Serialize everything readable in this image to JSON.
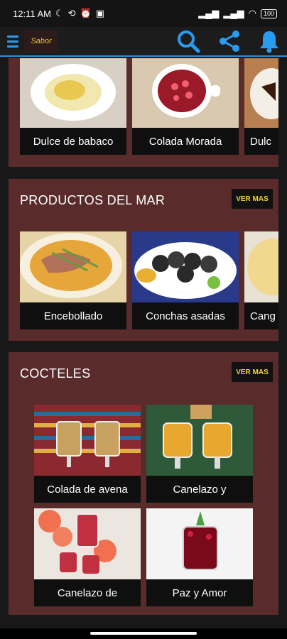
{
  "status_bar": {
    "time": "12:11 AM",
    "battery": "100"
  },
  "app": {
    "logo_text": "Sabor"
  },
  "sections": {
    "postres": {
      "items": [
        {
          "label": "Dulce de babaco",
          "image": "dulce-de-babaco"
        },
        {
          "label": "Colada Morada",
          "image": "colada-morada"
        },
        {
          "label": "Dulc",
          "image": "dessert-partial"
        }
      ]
    },
    "mar": {
      "title": "PRODUCTOS DEL MAR",
      "more_label": "VER MAS",
      "items": [
        {
          "label": "Encebollado",
          "image": "encebollado"
        },
        {
          "label": "Conchas asadas",
          "image": "conchas-asadas"
        },
        {
          "label": "Cang",
          "image": "cangrejo-partial"
        }
      ]
    },
    "cocteles": {
      "title": "COCTELES",
      "more_label": "VER MAS",
      "items": [
        {
          "label": "Colada de avena",
          "image": "colada-de-avena"
        },
        {
          "label": "Canelazo y",
          "image": "canelazo-y"
        },
        {
          "label": "Canelazo de",
          "image": "canelazo-de"
        },
        {
          "label": "Paz y Amor",
          "image": "paz-y-amor"
        }
      ]
    }
  },
  "colors": {
    "section_bg": "#5a2b2b",
    "accent_blue": "#2a9bf0",
    "ver_mas_text": "#f2d23c"
  }
}
